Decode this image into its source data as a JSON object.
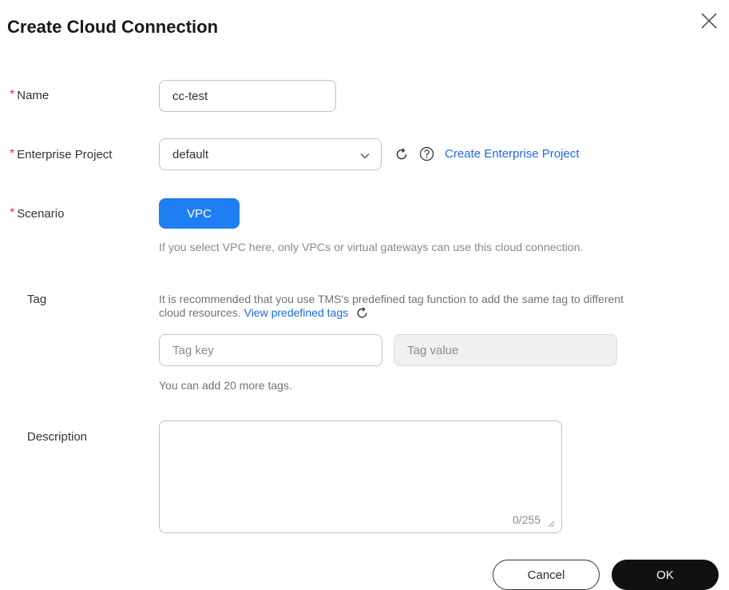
{
  "dialog": {
    "title": "Create Cloud Connection"
  },
  "form": {
    "required_mark": "*",
    "name": {
      "label": "Name",
      "value": "cc-test"
    },
    "enterprise_project": {
      "label": "Enterprise Project",
      "value": "default",
      "create_link": "Create Enterprise Project"
    },
    "scenario": {
      "label": "Scenario",
      "option": "VPC",
      "hint": "If you select VPC here, only VPCs or virtual gateways can use this cloud connection."
    },
    "tag": {
      "label": "Tag",
      "hint_line1": "It is recommended that you use TMS's predefined tag function to add the same tag to different",
      "hint_line2": "cloud resources.",
      "link": "View predefined tags",
      "key_placeholder": "Tag key",
      "value_placeholder": "Tag value",
      "remaining": "You can add 20 more tags."
    },
    "description": {
      "label": "Description",
      "counter": "0/255"
    }
  },
  "footer": {
    "cancel_label": "Cancel",
    "ok_label": "OK"
  },
  "colors": {
    "primary": "#1f7ef1",
    "link": "#1a6ce5",
    "required": "#e0383e",
    "ok_button": "#111111"
  },
  "icons": [
    "close-icon",
    "chevron-down-icon",
    "refresh-icon",
    "help-icon",
    "resize-handle-icon"
  ]
}
